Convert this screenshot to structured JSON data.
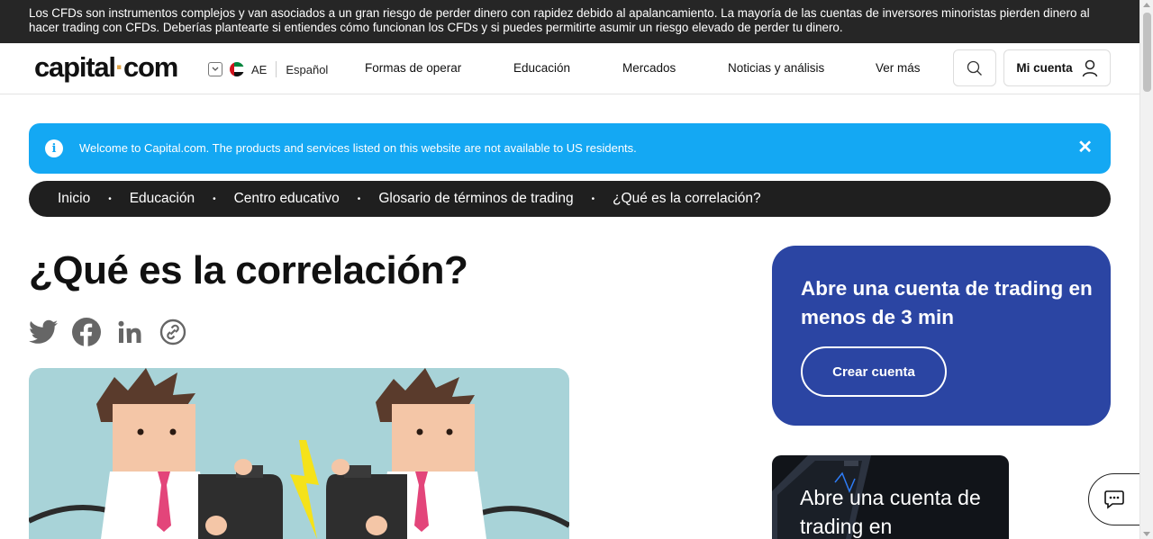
{
  "risk_banner": {
    "text": "Los CFDs son instrumentos complejos y van asociados a un gran riesgo de perder dinero con rapidez debido al apalancamiento. La mayoría de las cuentas de inversores minoristas pierden dinero al hacer trading con CFDs. Deberías plantearte si entiendes cómo funcionan los CFDs y si puedes permitirte asumir un riesgo elevado de perder tu dinero."
  },
  "header": {
    "logo_part1": "capital",
    "logo_dot": "·",
    "logo_part2": "com",
    "region_code": "AE",
    "language": "Español",
    "nav": [
      "Formas de operar",
      "Educación",
      "Mercados",
      "Noticias y análisis",
      "Ver más"
    ],
    "account_label": "Mi cuenta"
  },
  "info_banner": {
    "icon_glyph": "i",
    "text": "Welcome to Capital.com. The products and services listed on this website are not available to US residents.",
    "close_glyph": "✕"
  },
  "breadcrumb": [
    "Inicio",
    "Educación",
    "Centro educativo",
    "Glosario de términos de trading",
    "¿Qué es la correlación?"
  ],
  "breadcrumb_separator": "•",
  "article": {
    "title": "¿Qué es la correlación?"
  },
  "promo": {
    "title": "Abre una cuenta de trading en menos de 3 min",
    "button": "Crear cuenta"
  },
  "promo2": {
    "text": "Abre una cuenta de trading en"
  },
  "colors": {
    "info_blue": "#14a8f3",
    "promo_blue": "#2b45a3",
    "dark": "#1f1f1f",
    "logo_dot": "#e0a44a"
  },
  "icons": [
    "chevron-down-icon",
    "uae-flag-icon",
    "search-icon",
    "user-icon",
    "info-icon",
    "close-icon",
    "twitter-icon",
    "facebook-icon",
    "linkedin-icon",
    "link-icon",
    "chat-icon"
  ]
}
